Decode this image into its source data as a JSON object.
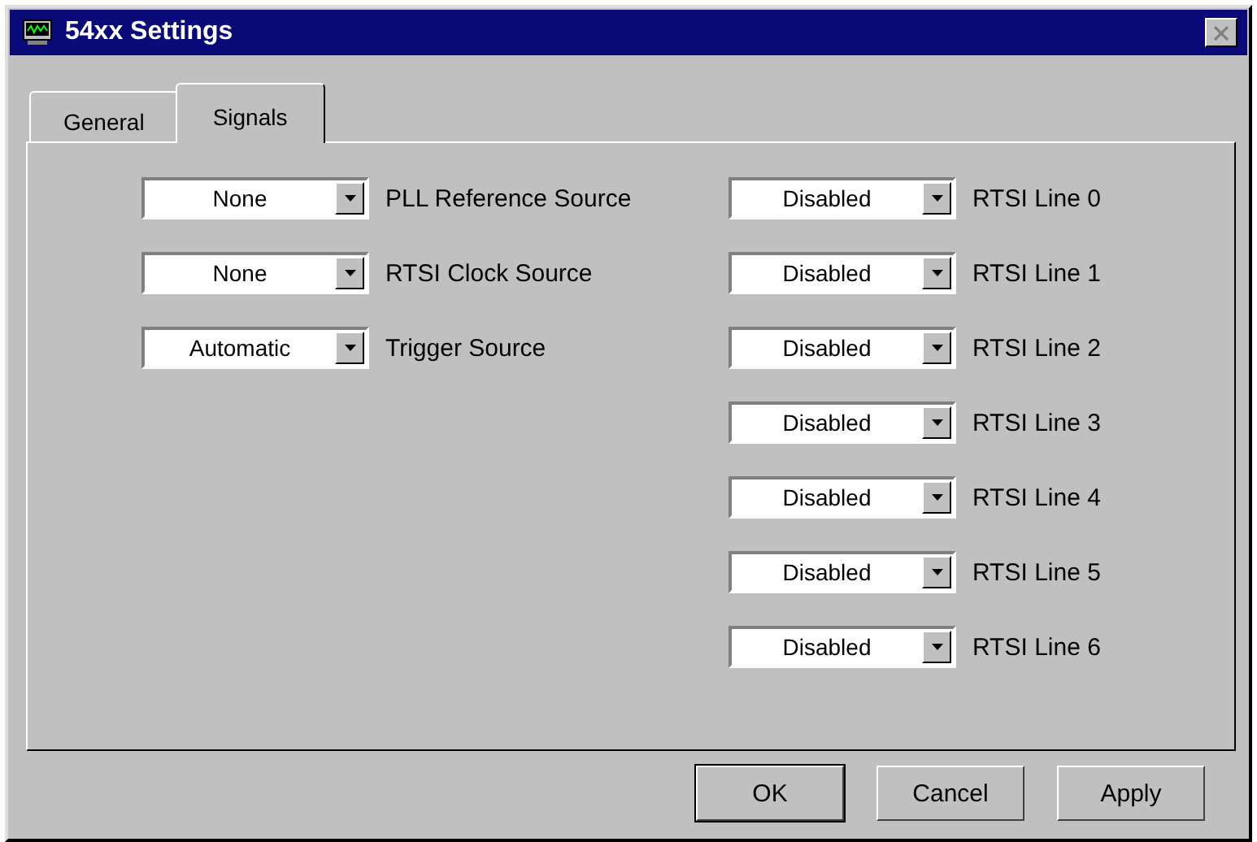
{
  "window": {
    "title": "54xx Settings"
  },
  "tabs": [
    {
      "label": "General",
      "selected": false
    },
    {
      "label": "Signals",
      "selected": true
    }
  ],
  "left_settings": [
    {
      "value": "None",
      "label": "PLL Reference Source"
    },
    {
      "value": "None",
      "label": "RTSI Clock Source"
    },
    {
      "value": "Automatic",
      "label": "Trigger Source"
    }
  ],
  "rtsi_lines": [
    {
      "value": "Disabled",
      "label": "RTSI Line 0"
    },
    {
      "value": "Disabled",
      "label": "RTSI Line 1"
    },
    {
      "value": "Disabled",
      "label": "RTSI Line 2"
    },
    {
      "value": "Disabled",
      "label": "RTSI Line 3"
    },
    {
      "value": "Disabled",
      "label": "RTSI Line 4"
    },
    {
      "value": "Disabled",
      "label": "RTSI Line 5"
    },
    {
      "value": "Disabled",
      "label": "RTSI Line 6"
    }
  ],
  "buttons": [
    {
      "label": "OK",
      "default": true
    },
    {
      "label": "Cancel",
      "default": false
    },
    {
      "label": "Apply",
      "default": false
    }
  ]
}
